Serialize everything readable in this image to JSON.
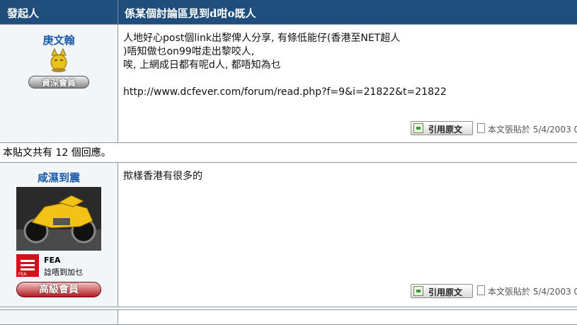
{
  "header": {
    "col_author": "發起人",
    "col_topic": "係某個討論區見到d咁o既人"
  },
  "post1": {
    "author": "庚文翰",
    "rank_label": "資深會員",
    "body_lines": [
      "人地好心post個link出黎俾人分享, 有條低能仔(香港至NET超人",
      ")唔知做乜on99咁走出黎咬人,",
      "唉, 上網成日都有呢d人, 都唔知為乜",
      "",
      "http://www.dcfever.com/forum/read.php?f=9&i=21822&t=21822"
    ],
    "quote_label": "引用原文",
    "posted_text": "本文張貼於 5/4/2003 0"
  },
  "replies_text": "本貼文共有 12 個回應。",
  "post2": {
    "author": "咸濕到震",
    "avatar_desc": "yellow-motorcycle-avatar",
    "sig_name": "FEA",
    "sig_text": "諗唔到加乜",
    "rank_label": "高級會員",
    "body_lines": [
      "揿樣香港有很多的"
    ],
    "quote_label": "引用原文",
    "posted_text": "本文張貼於 5/4/2003 0"
  },
  "colors": {
    "header_bg": "#1f4e7c",
    "author_blue": "#1a5aa8",
    "side_bg": "#f3f6f8"
  }
}
